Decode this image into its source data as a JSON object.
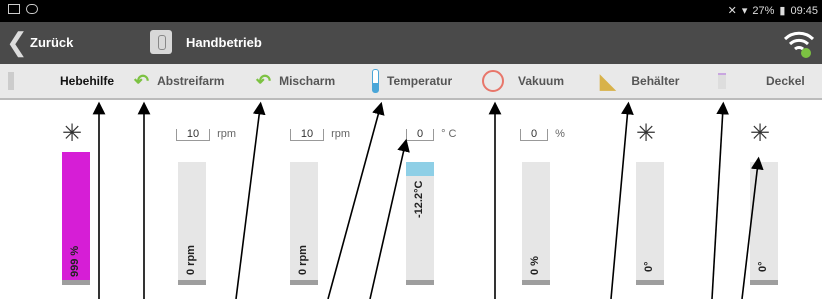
{
  "status": {
    "battery": "27%",
    "time": "09:45"
  },
  "appbar": {
    "back_label": "Zurück",
    "mode_label": "Handbetrieb"
  },
  "tabs": [
    {
      "label": "Hebehilfe",
      "icon": "lift-icon"
    },
    {
      "label": "Abstreifarm",
      "icon": "scraper-arm-icon"
    },
    {
      "label": "Mischarm",
      "icon": "mixer-arm-icon"
    },
    {
      "label": "Temperatur",
      "icon": "thermometer-icon"
    },
    {
      "label": "Vakuum",
      "icon": "vacuum-icon"
    },
    {
      "label": "Behälter",
      "icon": "container-icon"
    },
    {
      "label": "Deckel",
      "icon": "lid-icon"
    }
  ],
  "controls": {
    "abstreifarm": {
      "value": "10",
      "unit": "rpm",
      "bar_label": "0 rpm"
    },
    "mischarm": {
      "value": "10",
      "unit": "rpm",
      "bar_label": "0 rpm"
    },
    "temperatur": {
      "value": "0",
      "unit": "° C",
      "bar_label": "-12.2°C"
    },
    "vakuum": {
      "value": "0",
      "unit": "%",
      "bar_label": "0 %"
    },
    "hebehilfe": {
      "bar_label": "999 %"
    },
    "behaelter": {
      "bar_label": "0°"
    },
    "deckel": {
      "bar_label": "0°"
    }
  },
  "colors": {
    "hebehilfe_fill": "#d61ed6",
    "temp_fill": "#8ecfe6",
    "bar_bg": "#e6e6e6"
  }
}
